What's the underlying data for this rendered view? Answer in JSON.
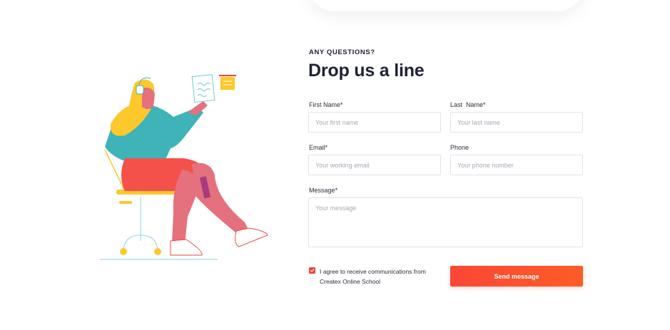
{
  "contact": {
    "eyebrow": "ANY QUESTIONS?",
    "title": "Drop us a line",
    "fields": {
      "first_name": {
        "label": "First Name*",
        "placeholder": "Your first name",
        "value": ""
      },
      "last_name": {
        "label": "Last  Name*",
        "placeholder": "Your last name",
        "value": ""
      },
      "email": {
        "label": "Email*",
        "placeholder": "Your working email",
        "value": ""
      },
      "phone": {
        "label": "Phone",
        "placeholder": "Your phone number",
        "value": ""
      },
      "message": {
        "label": "Message*",
        "placeholder": "Your message",
        "value": ""
      }
    },
    "consent": {
      "checked": true,
      "text": "I agree to receive communications from Createx Online School"
    },
    "submit_label": "Send message"
  },
  "illustration": {
    "icon": "woman-on-chair-holding-note-illustration",
    "colors": {
      "top": "#3eb3b8",
      "skirt": "#f4514b",
      "legs": "#e5707e",
      "hair": "#fcc82c",
      "accent": "#f4433b"
    }
  }
}
